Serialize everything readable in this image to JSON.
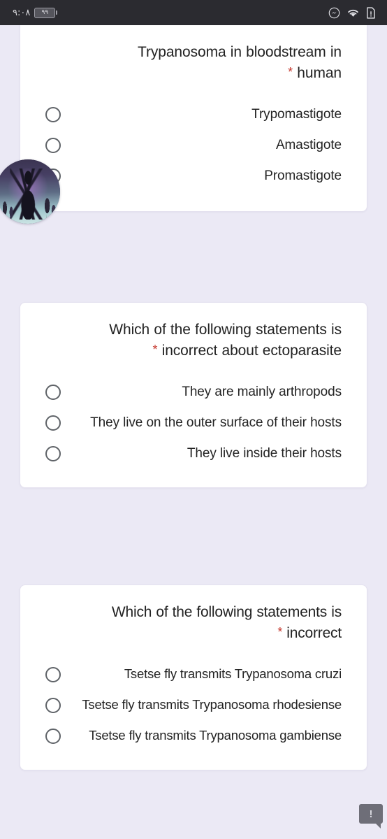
{
  "status_bar": {
    "clock": "٩:٠٨",
    "battery_level": "٩٩",
    "icons": [
      "messenger-icon",
      "wifi-icon",
      "sim-alert-icon"
    ],
    "background_color": "#2b2b30"
  },
  "theme": {
    "page_background": "#ebe9f5",
    "card_background": "#ffffff",
    "text_color": "#232323",
    "required_star_color": "#c5392f",
    "radio_border_color": "#5f6368"
  },
  "form": {
    "questions": [
      {
        "title_line_1": "Trypanosoma in bloodstream in",
        "title_line_2": "human",
        "required_marker": "*",
        "options": [
          {
            "label": "Trypomastigote",
            "selected": false
          },
          {
            "label": "Amastigote",
            "selected": false
          },
          {
            "label": "Promastigote",
            "selected": false
          }
        ]
      },
      {
        "title_line_1": "Which of the following statements is",
        "title_line_2": "incorrect about ectoparasite",
        "required_marker": "*",
        "options": [
          {
            "label": "They are mainly arthropods",
            "selected": false
          },
          {
            "label": "They live on the outer surface of their hosts",
            "selected": false
          },
          {
            "label": "They live inside their hosts",
            "selected": false
          }
        ]
      },
      {
        "title_line_1": "Which of the following statements is",
        "title_line_2": "incorrect",
        "required_marker": "*",
        "options": [
          {
            "label": "Tsetse fly transmits Trypanosoma cruzi",
            "selected": false
          },
          {
            "label": "Tsetse fly transmits Trypanosoma rhodesiense",
            "selected": false
          },
          {
            "label": "Tsetse fly transmits Trypanosoma gambiense",
            "selected": false
          }
        ]
      }
    ]
  },
  "overlays": {
    "avatar": {
      "name": "profile-avatar"
    },
    "report_badge": {
      "glyph": "!"
    }
  }
}
